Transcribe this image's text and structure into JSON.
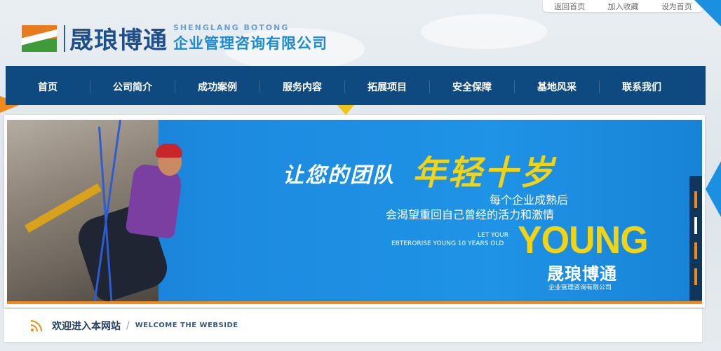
{
  "toplinks": [
    "返回首页",
    "加入收藏",
    "设为首页"
  ],
  "logo": {
    "cn": "晟琅博通",
    "en": "SHENGLANG BOTONG",
    "sub": "企业管理咨询有限公司"
  },
  "nav": [
    "首页",
    "公司简介",
    "成功案例",
    "服务内容",
    "拓展项目",
    "安全保障",
    "基地风采",
    "联系我们"
  ],
  "banner": {
    "slogan_white": "让您的团队",
    "slogan_yellow": "年轻十岁",
    "line1": "每个企业成熟后",
    "line2": "会渴望重回自己曾经的活力和激情",
    "let_your": "LET YOUR",
    "ebteroise": "EBTERORISE YOUNG 10 YEARS OLD",
    "young": "YOUNG",
    "brand": "晟琅博通",
    "brand_sub": "企业管理咨询有限公司",
    "slides_total": 4,
    "slide_active": 2
  },
  "welcome": {
    "cn": "欢迎进入本网站",
    "sep": "/",
    "en": "WELCOME THE WEBSIDE"
  },
  "colors": {
    "nav_bg": "#0e4a7f",
    "accent_orange": "#f08a1c",
    "accent_yellow": "#f3d413",
    "banner_blue": "#1c8ae0",
    "logo_blue": "#1f4f8a"
  }
}
